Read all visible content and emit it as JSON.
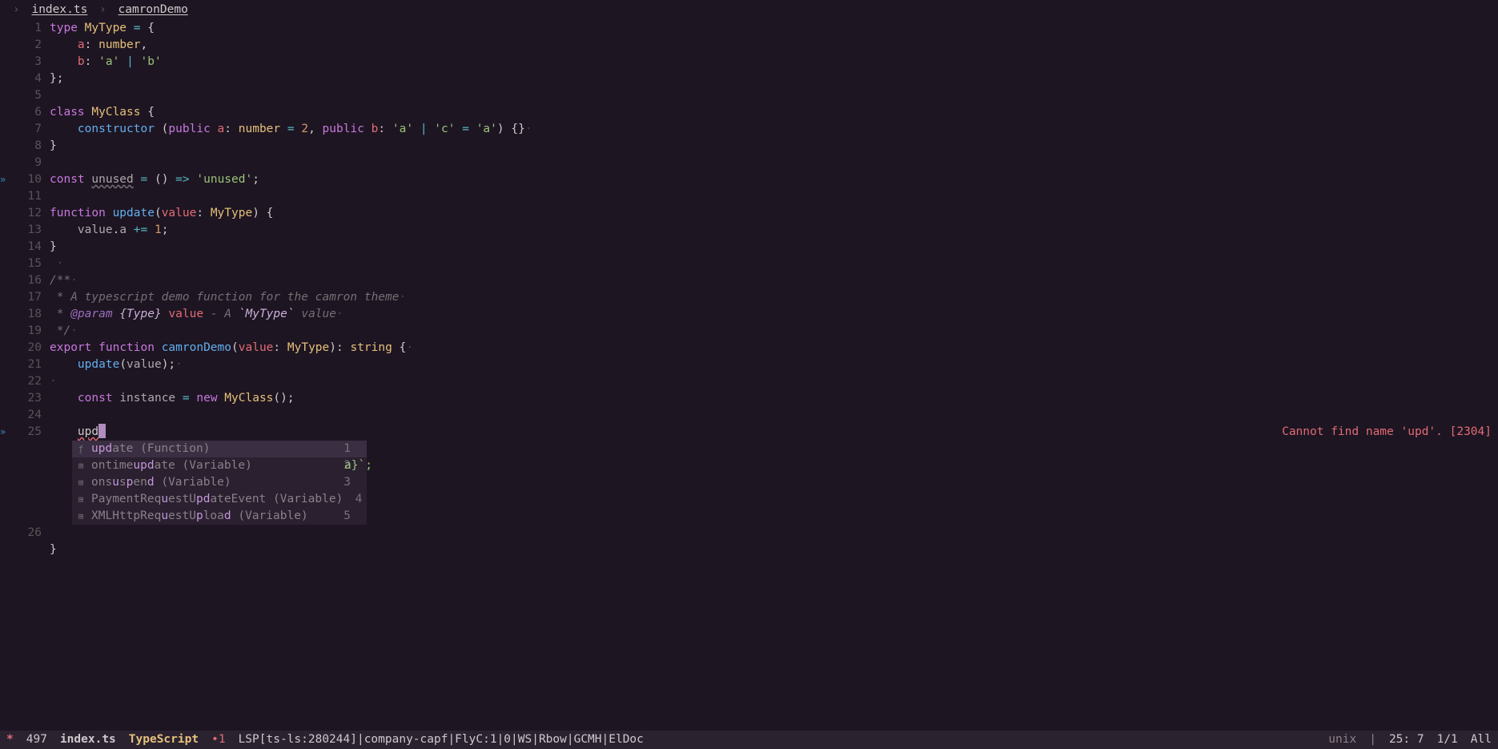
{
  "colors": {
    "bg": "#1e1522",
    "fg": "#d0c8cc",
    "accent": "#c678dd",
    "error": "#e06c75"
  },
  "breadcrumb": {
    "file": "index.ts",
    "symbol": "camronDemo"
  },
  "diagnostic": {
    "message": "Cannot find name 'upd'. [2304]",
    "line": 25
  },
  "cursor": {
    "line": 25,
    "col": 7,
    "text_before_cursor": "upd"
  },
  "code_lines": [
    {
      "n": 1,
      "fringe": "",
      "tokens": [
        [
          "kw",
          "type"
        ],
        [
          "va",
          " "
        ],
        [
          "ty",
          "MyType"
        ],
        [
          "va",
          " "
        ],
        [
          "op",
          "="
        ],
        [
          "va",
          " {"
        ]
      ]
    },
    {
      "n": 2,
      "fringe": "",
      "tokens": [
        [
          "va",
          "    "
        ],
        [
          "pa",
          "a"
        ],
        [
          "va",
          ": "
        ],
        [
          "ty",
          "number"
        ],
        [
          "va",
          ","
        ]
      ]
    },
    {
      "n": 3,
      "fringe": "",
      "tokens": [
        [
          "va",
          "    "
        ],
        [
          "pa",
          "b"
        ],
        [
          "va",
          ": "
        ],
        [
          "st",
          "'a'"
        ],
        [
          "va",
          " "
        ],
        [
          "op",
          "|"
        ],
        [
          "va",
          " "
        ],
        [
          "st",
          "'b'"
        ]
      ]
    },
    {
      "n": 4,
      "fringe": "",
      "tokens": [
        [
          "va",
          "};"
        ]
      ]
    },
    {
      "n": 5,
      "fringe": "",
      "tokens": []
    },
    {
      "n": 6,
      "fringe": "",
      "tokens": [
        [
          "kw",
          "class"
        ],
        [
          "va",
          " "
        ],
        [
          "ty",
          "MyClass"
        ],
        [
          "va",
          " {"
        ]
      ]
    },
    {
      "n": 7,
      "fringe": "",
      "tokens": [
        [
          "va",
          "    "
        ],
        [
          "fn",
          "constructor"
        ],
        [
          "va",
          " ("
        ],
        [
          "kw",
          "public"
        ],
        [
          "va",
          " "
        ],
        [
          "pa",
          "a"
        ],
        [
          "va",
          ": "
        ],
        [
          "ty",
          "number"
        ],
        [
          "va",
          " "
        ],
        [
          "op",
          "="
        ],
        [
          "va",
          " "
        ],
        [
          "nu",
          "2"
        ],
        [
          "va",
          ", "
        ],
        [
          "kw",
          "public"
        ],
        [
          "va",
          " "
        ],
        [
          "pa",
          "b"
        ],
        [
          "va",
          ": "
        ],
        [
          "st",
          "'a'"
        ],
        [
          "va",
          " "
        ],
        [
          "op",
          "|"
        ],
        [
          "va",
          " "
        ],
        [
          "st",
          "'c'"
        ],
        [
          "va",
          " "
        ],
        [
          "op",
          "="
        ],
        [
          "va",
          " "
        ],
        [
          "st",
          "'a'"
        ],
        [
          "va",
          ") {}"
        ],
        [
          "trail",
          "·"
        ]
      ]
    },
    {
      "n": 8,
      "fringe": "",
      "tokens": [
        [
          "va",
          "}"
        ]
      ]
    },
    {
      "n": 9,
      "fringe": "",
      "tokens": []
    },
    {
      "n": 10,
      "fringe": "»",
      "tokens": [
        [
          "kw",
          "const"
        ],
        [
          "va",
          " "
        ],
        [
          "unused",
          "unused"
        ],
        [
          "va",
          " "
        ],
        [
          "op",
          "="
        ],
        [
          "va",
          " () "
        ],
        [
          "op",
          "=>"
        ],
        [
          "va",
          " "
        ],
        [
          "st",
          "'unused'"
        ],
        [
          "va",
          ";"
        ]
      ]
    },
    {
      "n": 11,
      "fringe": "",
      "tokens": []
    },
    {
      "n": 12,
      "fringe": "",
      "tokens": [
        [
          "kw",
          "function"
        ],
        [
          "va",
          " "
        ],
        [
          "fn",
          "update"
        ],
        [
          "va",
          "("
        ],
        [
          "pa",
          "value"
        ],
        [
          "va",
          ": "
        ],
        [
          "ty",
          "MyType"
        ],
        [
          "va",
          ") {"
        ]
      ]
    },
    {
      "n": 13,
      "fringe": "",
      "tokens": [
        [
          "va",
          "    "
        ],
        [
          "id",
          "value"
        ],
        [
          "va",
          "."
        ],
        [
          "id",
          "a"
        ],
        [
          "va",
          " "
        ],
        [
          "op",
          "+="
        ],
        [
          "va",
          " "
        ],
        [
          "nu",
          "1"
        ],
        [
          "va",
          ";"
        ]
      ]
    },
    {
      "n": 14,
      "fringe": "",
      "tokens": [
        [
          "va",
          "}"
        ]
      ]
    },
    {
      "n": 15,
      "fringe": "",
      "tokens": [
        [
          "trail",
          " ·"
        ]
      ]
    },
    {
      "n": 16,
      "fringe": "",
      "tokens": [
        [
          "cm",
          "/**"
        ],
        [
          "trail",
          "·"
        ]
      ]
    },
    {
      "n": 17,
      "fringe": "",
      "tokens": [
        [
          "cm",
          " * A typescript demo function for the camron theme"
        ],
        [
          "trail",
          "·"
        ]
      ]
    },
    {
      "n": 18,
      "fringe": "",
      "tokens": [
        [
          "cm",
          " * "
        ],
        [
          "cmtag",
          "@param"
        ],
        [
          "cm",
          " "
        ],
        [
          "cmcode",
          "{Type}"
        ],
        [
          "cm",
          " "
        ],
        [
          "pa",
          "value"
        ],
        [
          "cm",
          " - A "
        ],
        [
          "cmcode",
          "`MyType`"
        ],
        [
          "cm",
          " value"
        ],
        [
          "trail",
          "·"
        ]
      ]
    },
    {
      "n": 19,
      "fringe": "",
      "tokens": [
        [
          "cm",
          " */"
        ],
        [
          "trail",
          "·"
        ]
      ]
    },
    {
      "n": 20,
      "fringe": "",
      "tokens": [
        [
          "kw",
          "export"
        ],
        [
          "va",
          " "
        ],
        [
          "kw",
          "function"
        ],
        [
          "va",
          " "
        ],
        [
          "fn",
          "camronDemo"
        ],
        [
          "va",
          "("
        ],
        [
          "pa",
          "value"
        ],
        [
          "va",
          ": "
        ],
        [
          "ty",
          "MyType"
        ],
        [
          "va",
          "): "
        ],
        [
          "ty",
          "string"
        ],
        [
          "va",
          " {"
        ],
        [
          "trail",
          "·"
        ]
      ]
    },
    {
      "n": 21,
      "fringe": "",
      "tokens": [
        [
          "va",
          "    "
        ],
        [
          "fn",
          "update"
        ],
        [
          "va",
          "("
        ],
        [
          "id",
          "value"
        ],
        [
          "va",
          ");"
        ],
        [
          "trail",
          "·"
        ]
      ]
    },
    {
      "n": 22,
      "fringe": "",
      "tokens": [
        [
          "trail",
          "·"
        ]
      ]
    },
    {
      "n": 23,
      "fringe": "",
      "tokens": [
        [
          "va",
          "    "
        ],
        [
          "kw",
          "const"
        ],
        [
          "va",
          " "
        ],
        [
          "id",
          "instance"
        ],
        [
          "va",
          " "
        ],
        [
          "op",
          "="
        ],
        [
          "va",
          " "
        ],
        [
          "kw",
          "new"
        ],
        [
          "va",
          " "
        ],
        [
          "ty",
          "MyClass"
        ],
        [
          "va",
          "();"
        ]
      ]
    },
    {
      "n": 24,
      "fringe": "",
      "tokens": []
    },
    {
      "n": 25,
      "fringe": "»",
      "tokens": [
        [
          "va",
          "    "
        ],
        [
          "err",
          "upd"
        ],
        [
          "cursor",
          ""
        ]
      ]
    },
    {
      "n": 26,
      "fringe": "",
      "tokens": [
        [
          "va",
          "    "
        ]
      ]
    },
    {
      "n": 27,
      "hide_num": true,
      "fringe": "",
      "tokens": [
        [
          "va",
          "}  "
        ]
      ]
    }
  ],
  "completion": {
    "behind_text": "a}`;",
    "items": [
      {
        "index": 1,
        "selected": true,
        "icon": "ƒ",
        "pre": "upd",
        "post": "ate",
        "type": "(Function)"
      },
      {
        "index": 2,
        "selected": false,
        "icon": "⊞",
        "before": "ontime",
        "pre": "upd",
        "post": "ate",
        "type": "(Variable)"
      },
      {
        "index": 3,
        "selected": false,
        "icon": "⊞",
        "before": "ons",
        "pre": "u",
        "mid": "s",
        "pre2": "p",
        "mid2": "en",
        "pre3": "d",
        "post": "",
        "type": "(Variable)"
      },
      {
        "index": 4,
        "selected": false,
        "icon": "⊞",
        "before": "PaymentReq",
        "pre": "u",
        "mid": "estU",
        "pre2": "pd",
        "post": "ateEvent",
        "type": "(Variable)"
      },
      {
        "index": 5,
        "selected": false,
        "icon": "⊞",
        "before": "XMLHttpReq",
        "pre": "u",
        "mid": "estU",
        "pre2": "p",
        "mid2": "loa",
        "pre3": "d",
        "post": "",
        "type": "(Variable)"
      }
    ]
  },
  "statusbar": {
    "modified": "*",
    "size": "497",
    "filename": "index.ts",
    "major_mode": "TypeScript",
    "err_count": "1",
    "segments": "LSP[ts-ls:280244]|company-capf|FlyC:1|0|WS|Rbow|GCMH|ElDoc",
    "encoding": "unix",
    "position": "25: 7",
    "page": "1/1",
    "scroll": "All"
  }
}
